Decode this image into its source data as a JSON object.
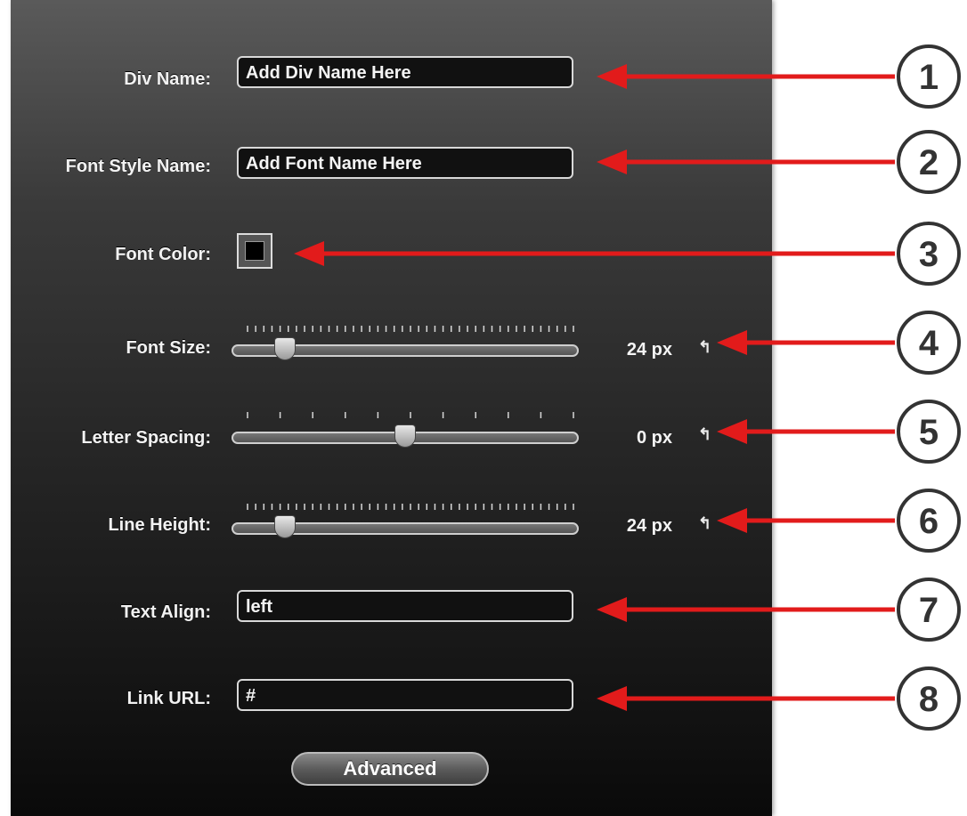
{
  "fields": {
    "div_name": {
      "label": "Div Name:",
      "value": "Add Div Name Here"
    },
    "font_style_name": {
      "label": "Font Style Name:",
      "value": "Add Font Name Here"
    },
    "font_color": {
      "label": "Font Color:",
      "color": "#000000"
    },
    "font_size": {
      "label": "Font Size:",
      "value": "24 px",
      "level": 0.15
    },
    "letter_spacing": {
      "label": "Letter Spacing:",
      "value": "0 px",
      "level": 0.5
    },
    "line_height": {
      "label": "Line Height:",
      "value": "24 px",
      "level": 0.15
    },
    "text_align": {
      "label": "Text Align:",
      "value": "left"
    },
    "link_url": {
      "label": "Link URL:",
      "value": "#"
    }
  },
  "reset_glyph": "↰",
  "advanced_button": "Advanced",
  "callouts": [
    "1",
    "2",
    "3",
    "4",
    "5",
    "6",
    "7",
    "8"
  ],
  "colors": {
    "arrow": "#e21b1b",
    "callout_stroke": "#333333",
    "panel_top": "#5a5a5a",
    "panel_bottom": "#0a0a0a"
  }
}
